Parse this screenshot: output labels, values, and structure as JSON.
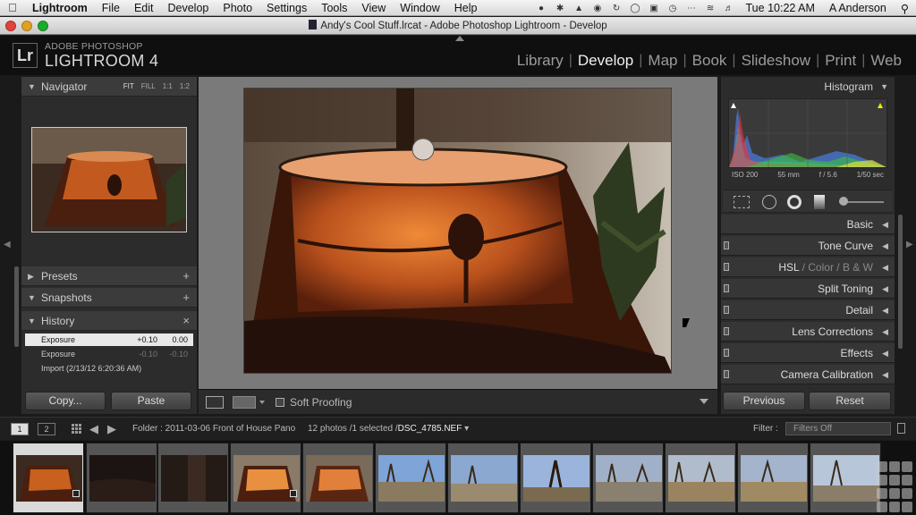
{
  "menubar": {
    "items": [
      "Lightroom",
      "File",
      "Edit",
      "Develop",
      "Photo",
      "Settings",
      "Tools",
      "View",
      "Window",
      "Help"
    ],
    "clock": "Tue 10:22 AM",
    "user": "A Anderson"
  },
  "window": {
    "title": "Andy's Cool Stuff.lrcat - Adobe Photoshop Lightroom - Develop"
  },
  "identity": {
    "logo": "Lr",
    "brand_small": "ADOBE PHOTOSHOP",
    "brand_big": "LIGHTROOM 4"
  },
  "modules": [
    "Library",
    "Develop",
    "Map",
    "Book",
    "Slideshow",
    "Print",
    "Web"
  ],
  "active_module": "Develop",
  "left_panel": {
    "navigator": {
      "title": "Navigator",
      "options": [
        "FIT",
        "FILL",
        "1:1",
        "1:2"
      ],
      "active_option": "FIT"
    },
    "presets": {
      "title": "Presets",
      "action": "+"
    },
    "snapshots": {
      "title": "Snapshots",
      "action": "+"
    },
    "history": {
      "title": "History",
      "action": "×",
      "rows": [
        {
          "label": "Exposure",
          "delta": "+0.10",
          "value": "0.00"
        },
        {
          "label": "Exposure",
          "delta": "-0.10",
          "value": "-0.10"
        },
        {
          "label": "Import (2/13/12 6:20:36 AM)",
          "delta": "",
          "value": ""
        }
      ]
    },
    "copy_label": "Copy...",
    "paste_label": "Paste"
  },
  "toolbar": {
    "soft_proofing": "Soft Proofing"
  },
  "right_panel": {
    "histogram": {
      "title": "Histogram",
      "iso": "ISO 200",
      "focal": "55 mm",
      "aperture": "f / 5.6",
      "shutter": "1/50 sec"
    },
    "sections": [
      "Basic",
      "Tone Curve",
      "HSL",
      "Color",
      "B & W",
      "Split Toning",
      "Detail",
      "Lens Corrections",
      "Effects",
      "Camera Calibration"
    ],
    "previous_label": "Previous",
    "reset_label": "Reset"
  },
  "filmbar": {
    "screen1": "1",
    "screen2": "2",
    "folder": "Folder : 2011-03-06 Front of House Pano",
    "selection_count": "12 photos /1 selected /",
    "selected_file": "DSC_4785.NEF",
    "filter_label": "Filter :",
    "filter_value": "Filters Off"
  },
  "filmstrip": {
    "count": 12,
    "selected_index": 0
  }
}
